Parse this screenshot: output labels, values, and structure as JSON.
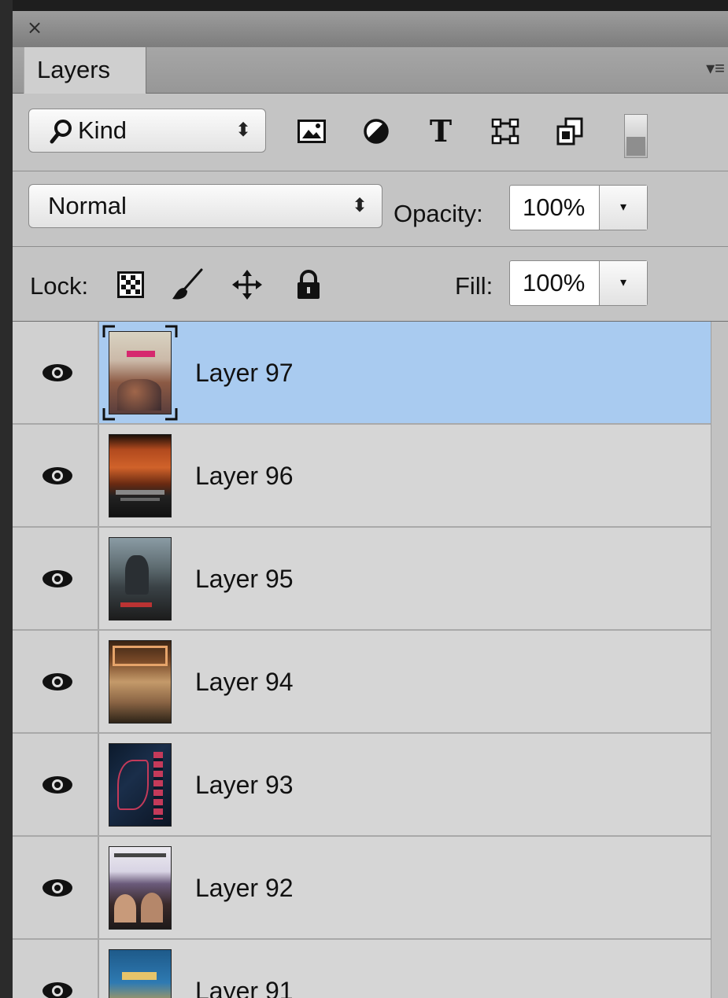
{
  "panel": {
    "close_glyph": "×",
    "tab_label": "Layers",
    "menu_glyph": "▾≡"
  },
  "filter": {
    "kind_label": "Kind",
    "updown_glyph": "⬍",
    "icons": [
      "image-filter-icon",
      "adjustment-filter-icon",
      "type-filter-icon",
      "shape-filter-icon",
      "smart-object-filter-icon"
    ],
    "type_glyph": "T"
  },
  "blend": {
    "mode": "Normal",
    "updown_glyph": "⬍",
    "opacity_label": "Opacity:",
    "opacity_value": "100%",
    "dropdown_glyph": "▾"
  },
  "lock": {
    "label": "Lock:",
    "icons": [
      "lock-transparent-pixels-icon",
      "lock-image-pixels-icon",
      "lock-position-icon",
      "lock-all-icon"
    ],
    "fill_label": "Fill:",
    "fill_value": "100%",
    "dropdown_glyph": "▾"
  },
  "layers": [
    {
      "name": "Layer 97",
      "selected": true
    },
    {
      "name": "Layer 96",
      "selected": false
    },
    {
      "name": "Layer 95",
      "selected": false
    },
    {
      "name": "Layer 94",
      "selected": false
    },
    {
      "name": "Layer 93",
      "selected": false
    },
    {
      "name": "Layer 92",
      "selected": false
    },
    {
      "name": "Layer 91",
      "selected": false
    }
  ],
  "colors": {
    "selection": "#a9cbf0",
    "panel": "#c4c4c4",
    "row": "#d6d6d6"
  }
}
